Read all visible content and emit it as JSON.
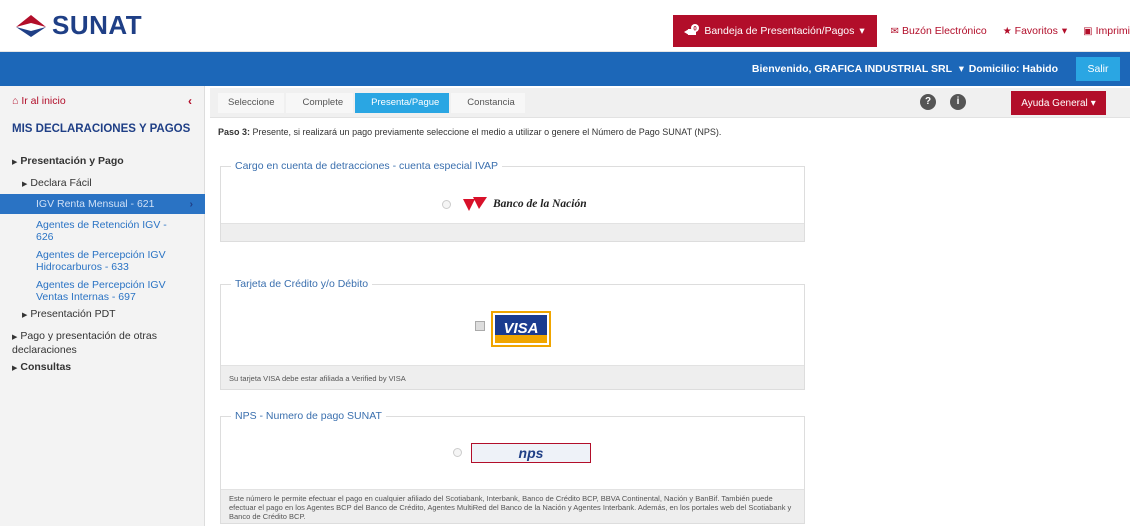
{
  "header": {
    "logo_text": "SUNAT",
    "bandeja_label": "Bandeja de Presentación/Pagos",
    "buzon_label": "Buzón Electrónico",
    "favoritos_label": "Favoritos",
    "imprimir_label": "Imprimi",
    "dropdown_glyph": "▾",
    "brand_red": "#b20e2a",
    "brand_blue": "#1f3f86"
  },
  "bluebar": {
    "welcome": "Bienvenido, GRAFICA INDUSTRIAL SRL",
    "domicilio": "Domicilio: Habido",
    "salir": "Salir",
    "color": "#1c67b8"
  },
  "sidebar": {
    "home_label": "Ir al inicio",
    "back_glyph": "‹",
    "title": "MIS DECLARACIONES Y PAGOS",
    "items": [
      {
        "label": "Presentación y Pago"
      },
      {
        "label": "Declara Fácil"
      },
      {
        "label": "IGV Renta Mensual - 621"
      },
      {
        "label": "Agentes de Retención IGV - 626"
      },
      {
        "label": "Agentes de Percepción IGV Hidrocarburos - 633"
      },
      {
        "label": "Agentes de Percepción IGV Ventas Internas - 697"
      },
      {
        "label": "Presentación PDT"
      },
      {
        "label": "Pago y presentación de otras declaraciones"
      },
      {
        "label": "Consultas"
      }
    ]
  },
  "steps": {
    "items": [
      "Seleccione",
      "Complete",
      "Presenta/Pague",
      "Constancia"
    ],
    "active_index": 2,
    "help_glyph": "?",
    "info_glyph": "i",
    "ayuda_label": "Ayuda General"
  },
  "paso": {
    "bold": "Paso 3:",
    "text": " Presente, si realizará un pago previamente seleccione el medio a utilizar o genere el Número de Pago SUNAT (NPS)."
  },
  "cards": {
    "detracciones": {
      "legend": "Cargo en cuenta de detracciones - cuenta especial IVAP",
      "bank_name": "Banco de la Nación"
    },
    "tarjeta": {
      "legend": "Tarjeta de Crédito y/o Débito",
      "visa_text": "VISA",
      "footer": "Su tarjeta VISA debe estar afiliada a Verified by VISA"
    },
    "nps": {
      "legend": "NPS - Numero de pago SUNAT",
      "nps_text": "nps",
      "footer": "Este número le permite efectuar el pago en cualquier afiliado del Scotiabank, Interbank, Banco de Crédito BCP, BBVA Continental, Nación y BanBif. También puede efectuar el pago en los Agentes BCP del Banco de Crédito, Agentes MultiRed del Banco de la Nación y Agentes Interbank. Además, en los portales web del Scotiabank y Banco de Crédito BCP."
    }
  }
}
